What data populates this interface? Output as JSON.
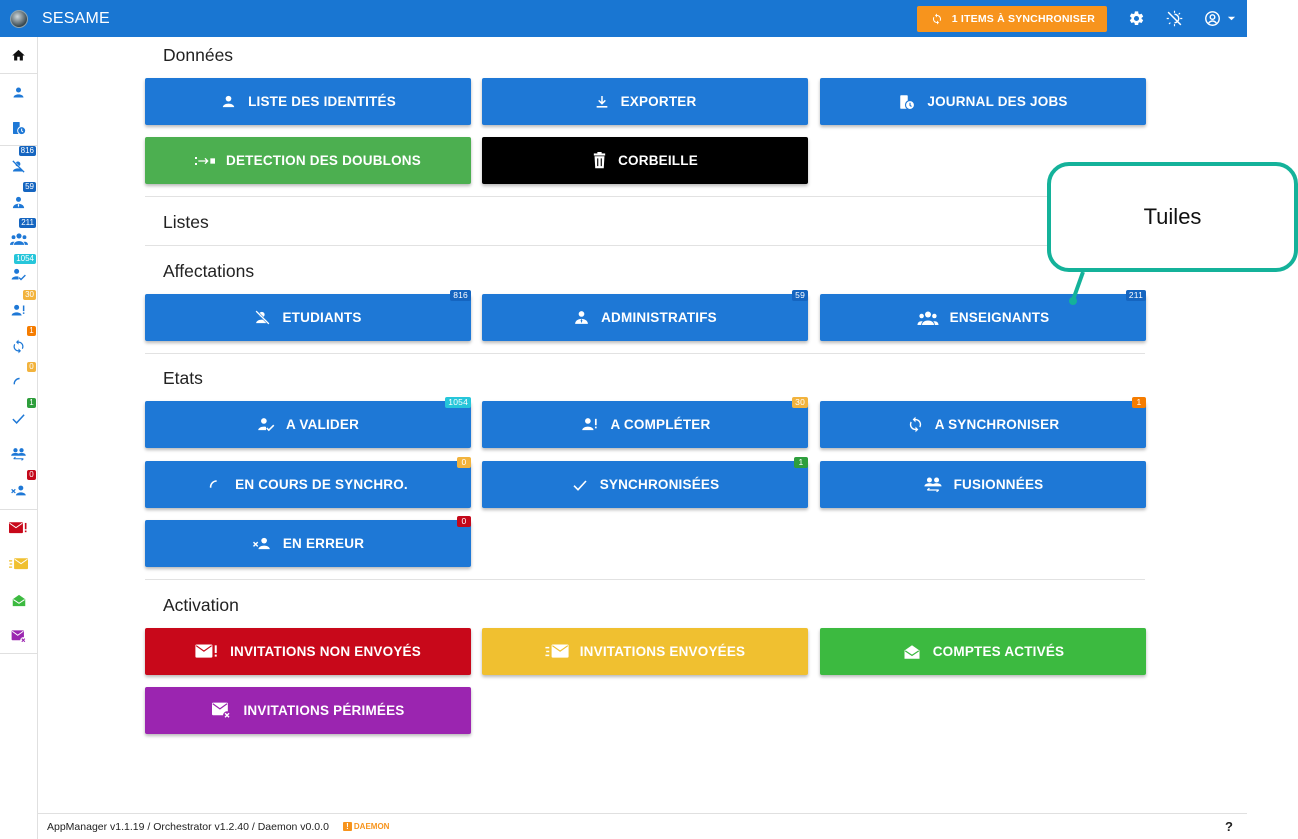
{
  "header": {
    "app_title": "SESAME",
    "sync_button_label": "1 ITEMS À SYNCHRONISER",
    "colors": {
      "bar": "#1976d2",
      "sync": "#f7941d"
    }
  },
  "sidebar": {
    "badges": {
      "etudiants": "816",
      "administratifs": "59",
      "enseignants": "211",
      "a_valider": "1054",
      "a_completer": "30",
      "a_synchroniser": "1",
      "en_cours": "0",
      "synchronisees": "1",
      "en_erreur": "0"
    }
  },
  "sections": {
    "donnees": "Données",
    "listes": "Listes",
    "affectations": "Affectations",
    "etats": "Etats",
    "activation": "Activation"
  },
  "tiles": {
    "liste_identites": "LISTE DES IDENTITÉS",
    "exporter": "EXPORTER",
    "journal_jobs": "JOURNAL DES JOBS",
    "detection_doublons": "DETECTION DES DOUBLONS",
    "corbeille": "CORBEILLE",
    "etudiants": {
      "label": "ETUDIANTS",
      "badge": "816"
    },
    "administratifs": {
      "label": "ADMINISTRATIFS",
      "badge": "59"
    },
    "enseignants": {
      "label": "ENSEIGNANTS",
      "badge": "211"
    },
    "a_valider": {
      "label": "A VALIDER",
      "badge": "1054"
    },
    "a_completer": {
      "label": "A COMPLÉTER",
      "badge": "30"
    },
    "a_synchroniser": {
      "label": "A SYNCHRONISER",
      "badge": "1"
    },
    "en_cours": {
      "label": "EN COURS DE SYNCHRO.",
      "badge": "0"
    },
    "synchronisees": {
      "label": "SYNCHRONISÉES",
      "badge": "1"
    },
    "fusionnees": "FUSIONNÉES",
    "en_erreur": {
      "label": "EN ERREUR",
      "badge": "0"
    },
    "invitations_non_envoyes": "INVITATIONS NON ENVOYÉS",
    "invitations_envoyees": "INVITATIONS ENVOYÉES",
    "comptes_actives": "COMPTES ACTIVÉS",
    "invitations_perimees": "INVITATIONS PÉRIMÉES"
  },
  "colors": {
    "tile_blue": "#1e78d6",
    "tile_green": "#4caf50",
    "tile_black": "#000000",
    "tile_red": "#c8081a",
    "tile_yellow": "#f0c030",
    "tile_green_bright": "#3cba40",
    "tile_purple": "#9b25b0",
    "badge_blue": "#1565c0",
    "badge_cyan": "#26c6da",
    "badge_amber": "#f2b33d",
    "badge_orange": "#f57c00",
    "badge_green": "#2e9e3c",
    "badge_red": "#c4081a",
    "callout_border": "#14b29a"
  },
  "footer": {
    "versions": "AppManager v1.1.19 / Orchestrator v1.2.40 / Daemon v0.0.0",
    "daemon_label": "DAEMON",
    "daemon_flag": "!",
    "help": "?"
  },
  "callout": {
    "text": "Tuiles"
  }
}
